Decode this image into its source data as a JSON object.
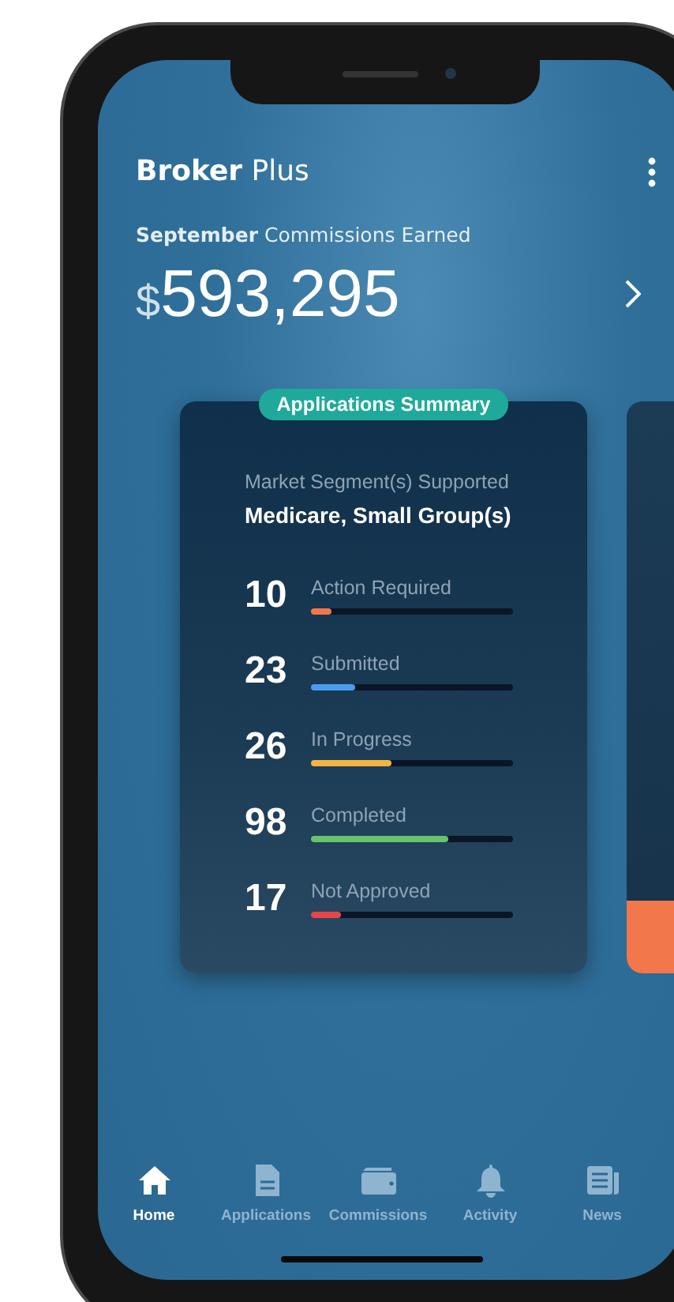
{
  "app": {
    "title_bold": "Broker",
    "title_rest": "Plus"
  },
  "commissions": {
    "label": "**September** Commissions Earned",
    "currency": "$",
    "amount": "593,295"
  },
  "summary_card": {
    "badge": "Applications Summary",
    "segment_label": "Market Segment(s) Supported",
    "segment_value": "Medicare, Small Group(s)",
    "stats": [
      {
        "count": "10",
        "label": "Action Required",
        "level": 0.1,
        "color": "#f2774b"
      },
      {
        "count": "23",
        "label": "Submitted",
        "level": 0.22,
        "color": "#4a9cf0"
      },
      {
        "count": "26",
        "label": "In Progress",
        "level": 0.4,
        "color": "#f5b342"
      },
      {
        "count": "98",
        "label": "Completed",
        "level": 0.68,
        "color": "#67c46a"
      },
      {
        "count": "17",
        "label": "Not Approved",
        "level": 0.15,
        "color": "#e8454a"
      }
    ]
  },
  "tab_bar": [
    {
      "label": "Home",
      "selected": true
    },
    {
      "label": "Applications",
      "selected": false
    },
    {
      "label": "Commissions",
      "selected": false
    },
    {
      "label": "Activity",
      "selected": false
    },
    {
      "label": "News",
      "selected": false
    }
  ]
}
